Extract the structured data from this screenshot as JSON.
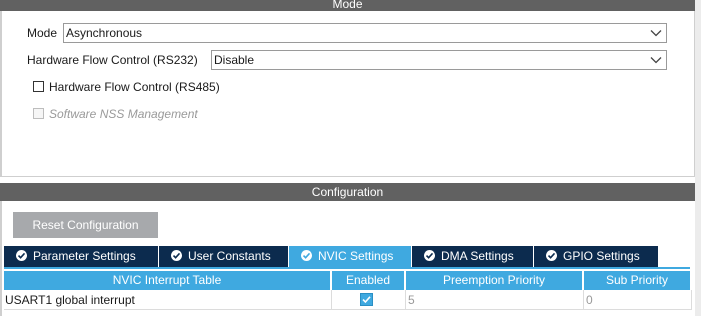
{
  "mode_section": {
    "title": "Mode",
    "mode": {
      "label": "Mode",
      "value": "Asynchronous"
    },
    "hw_flow_rs232": {
      "label": "Hardware Flow Control (RS232)",
      "value": "Disable"
    },
    "hw_flow_rs485": {
      "label": "Hardware Flow Control (RS485)",
      "checked": false
    },
    "software_nss": {
      "label": "Software NSS Management",
      "checked": false,
      "disabled": true
    }
  },
  "configuration": {
    "title": "Configuration",
    "reset_button": "Reset Configuration",
    "tabs": [
      {
        "label": "Parameter Settings",
        "active": false
      },
      {
        "label": "User Constants",
        "active": false
      },
      {
        "label": "NVIC Settings",
        "active": true
      },
      {
        "label": "DMA Settings",
        "active": false
      },
      {
        "label": "GPIO Settings",
        "active": false
      }
    ],
    "table": {
      "headers": [
        "NVIC Interrupt Table",
        "Enabled",
        "Preemption Priority",
        "Sub Priority"
      ],
      "rows": [
        {
          "name": "USART1 global interrupt",
          "enabled": true,
          "preemption": "5",
          "sub": "0"
        }
      ]
    }
  },
  "colors": {
    "header_bg": "#616161",
    "tab_inactive": "#0c2b4e",
    "tab_active": "#3fa9e0",
    "reset_button_bg": "#a7a9ac"
  },
  "icons": [
    "chevron-down-icon",
    "checkmark-circle-icon",
    "checkmark-icon"
  ]
}
